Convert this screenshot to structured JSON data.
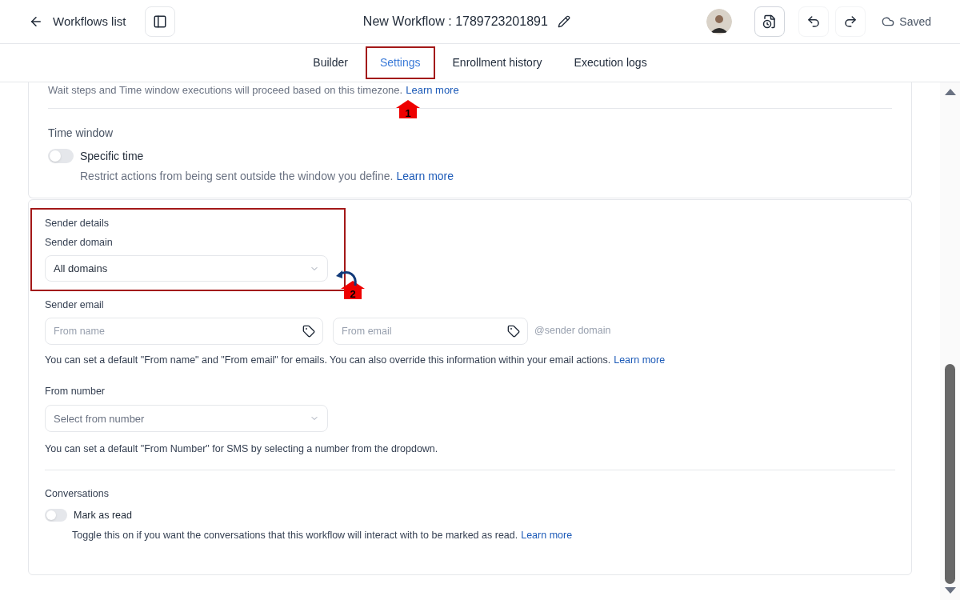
{
  "header": {
    "back_label": "Workflows list",
    "title": "New Workflow : 1789723201891",
    "status": "Saved"
  },
  "tabs": [
    {
      "label": "Builder",
      "selected": false
    },
    {
      "label": "Settings",
      "selected": true
    },
    {
      "label": "Enrollment history",
      "selected": false
    },
    {
      "label": "Execution logs",
      "selected": false
    }
  ],
  "timezone_note": {
    "text": "Wait steps and Time window executions will proceed based on this timezone.",
    "link": "Learn more"
  },
  "time_window": {
    "heading": "Time window",
    "toggle": {
      "label": "Specific time",
      "on": false
    },
    "help": "Restrict actions from being sent outside the window you define.",
    "link": "Learn more"
  },
  "sender_details": {
    "heading": "Sender details",
    "domain_label": "Sender domain",
    "domain_value": "All domains",
    "email_label": "Sender email",
    "from_name_placeholder": "From name",
    "from_email_placeholder": "From email",
    "domain_suffix": "@sender domain",
    "help": "You can set a default \"From name\" and \"From email\" for emails. You can also override this information within your email actions.",
    "link": "Learn more"
  },
  "from_number": {
    "label": "From number",
    "placeholder": "Select from number",
    "help": "You can set a default \"From Number\" for SMS by selecting a number from the dropdown."
  },
  "conversations": {
    "heading": "Conversations",
    "toggle": {
      "label": "Mark as read",
      "on": false
    },
    "help": "Toggle this on if you want the conversations that this workflow will interact with to be marked as read.",
    "link": "Learn more"
  },
  "annotations": [
    {
      "number": "1"
    },
    {
      "number": "2"
    }
  ]
}
